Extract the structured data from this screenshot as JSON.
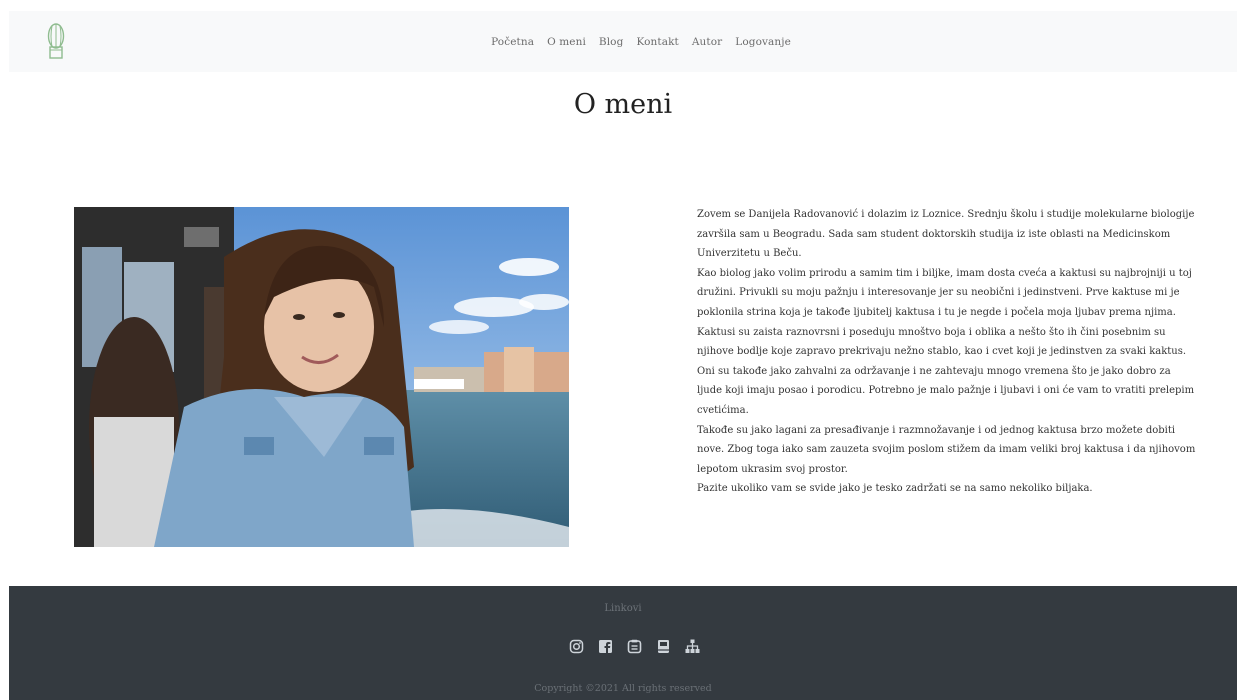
{
  "nav": {
    "links": [
      "Početna",
      "O meni",
      "Blog",
      "Kontakt",
      "Autor",
      "Logovanje"
    ]
  },
  "main": {
    "title": "O meni",
    "paragraphs": [
      "Zovem se Danijela Radovanović i dolazim iz Loznice. Srednju školu i studije molekularne biologije završila sam u Beogradu. Sada sam student doktorskih studija iz iste oblasti na Medicinskom Univerzitetu u Beču.",
      "Kao biolog jako volim prirodu a samim tim i biljke, imam dosta cveća a kaktusi su najbrojniji u toj družini. Privukli su moju pažnju i interesovanje jer su neobični i jedinstveni. Prve kaktuse mi je poklonila strina koja je takođe ljubitelj kaktusa i tu je negde i počela moja ljubav prema njima.",
      "Kaktusi su zaista raznovrsni i poseduju mnoštvo boja i oblika a nešto što ih čini posebnim su njihove bodlje koje zapravo prekrivaju nežno stablo, kao i cvet koji je jedinstven za svaki kaktus. Oni su takođe jako zahvalni za održavanje i ne zahtevaju mnogo vremena što je jako dobro za ljude koji imaju posao i porodicu. Potrebno je malo pažnje i ljubavi i oni će vam to vratiti prelepim cvetićima.",
      "Takođe su jako lagani za presađivanje i razmnožavanje i od jednog kaktusa brzo možete dobiti nove. Zbog toga iako sam zauzeta svojim poslom stižem da imam veliki broj kaktusa i da njihovom lepotom ukrasim svoj prostor.",
      "Pazite ukoliko vam se svide jako je tesko zadržati se na samo nekoliko biljaka."
    ]
  },
  "footer": {
    "heading": "Linkovi",
    "icons": [
      "instagram-icon",
      "facebook-icon",
      "document-icon",
      "book-icon",
      "sitemap-icon"
    ],
    "copyright": "Copyright ©2021 All rights reserved"
  },
  "colors": {
    "navbar_bg": "#f8f9fa",
    "footer_bg": "#343a40",
    "nav_link": "#6c6c6c",
    "footer_icon": "#ced4da",
    "cactus_green": "#8fbc8f"
  }
}
